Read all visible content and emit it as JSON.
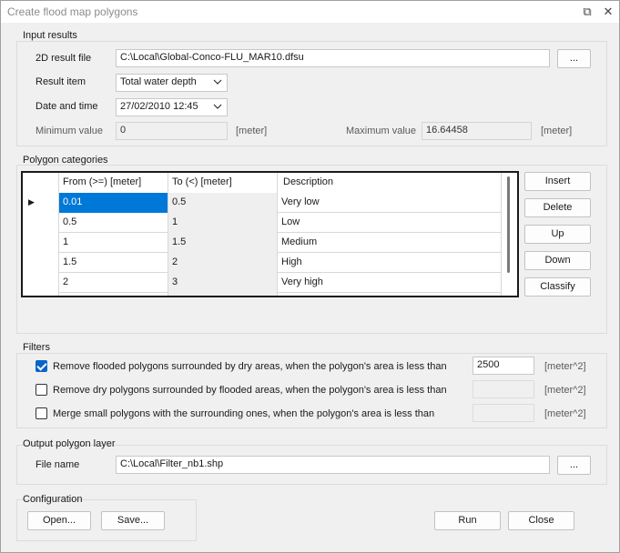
{
  "window": {
    "title": "Create flood map polygons",
    "restore_glyph": "⧉",
    "close_glyph": "✕"
  },
  "input_results": {
    "group_title": "Input results",
    "result_file_label": "2D result file",
    "result_file_value": "C:\\Local\\Global-Conco-FLU_MAR10.dfsu",
    "browse_label": "...",
    "result_item_label": "Result item",
    "result_item_value": "Total water depth",
    "date_label": "Date and time",
    "date_value": "27/02/2010 12:45",
    "min_label": "Minimum value",
    "min_value": "0",
    "min_unit": "[meter]",
    "max_label": "Maximum value",
    "max_value": "16.64458",
    "max_unit": "[meter]"
  },
  "polygon_categories": {
    "group_title": "Polygon categories",
    "columns": [
      "From (>=) [meter]",
      "To (<) [meter]",
      "Description"
    ],
    "rows": [
      {
        "from": "0.01",
        "to": "0.5",
        "desc": "Very low"
      },
      {
        "from": "0.5",
        "to": "1",
        "desc": "Low"
      },
      {
        "from": "1",
        "to": "1.5",
        "desc": "Medium"
      },
      {
        "from": "1.5",
        "to": "2",
        "desc": "High"
      },
      {
        "from": "2",
        "to": "3",
        "desc": "Very high"
      }
    ],
    "current_row_marker": "▶",
    "buttons": {
      "insert": "Insert",
      "delete": "Delete",
      "up": "Up",
      "down": "Down",
      "classify": "Classify"
    }
  },
  "filters": {
    "group_title": "Filters",
    "items": [
      {
        "label": "Remove flooded polygons surrounded by dry areas, when the polygon's area is less than",
        "checked": true,
        "value": "2500",
        "unit": "[meter^2]"
      },
      {
        "label": "Remove dry polygons surrounded by flooded areas, when the polygon's area is less than",
        "checked": false,
        "value": "",
        "unit": "[meter^2]"
      },
      {
        "label": "Merge small polygons with the surrounding ones, when the polygon's area is less than",
        "checked": false,
        "value": "",
        "unit": "[meter^2]"
      }
    ]
  },
  "output": {
    "group_title": "Output polygon layer",
    "file_label": "File name",
    "file_value": "C:\\Local\\Filter_nb1.shp",
    "browse_label": "..."
  },
  "configuration": {
    "group_title": "Configuration",
    "open_label": "Open...",
    "save_label": "Save..."
  },
  "actions": {
    "run_label": "Run",
    "close_label": "Close"
  },
  "colors": {
    "selection": "#0078d7",
    "checkbox_checked": "#0a64c8"
  }
}
